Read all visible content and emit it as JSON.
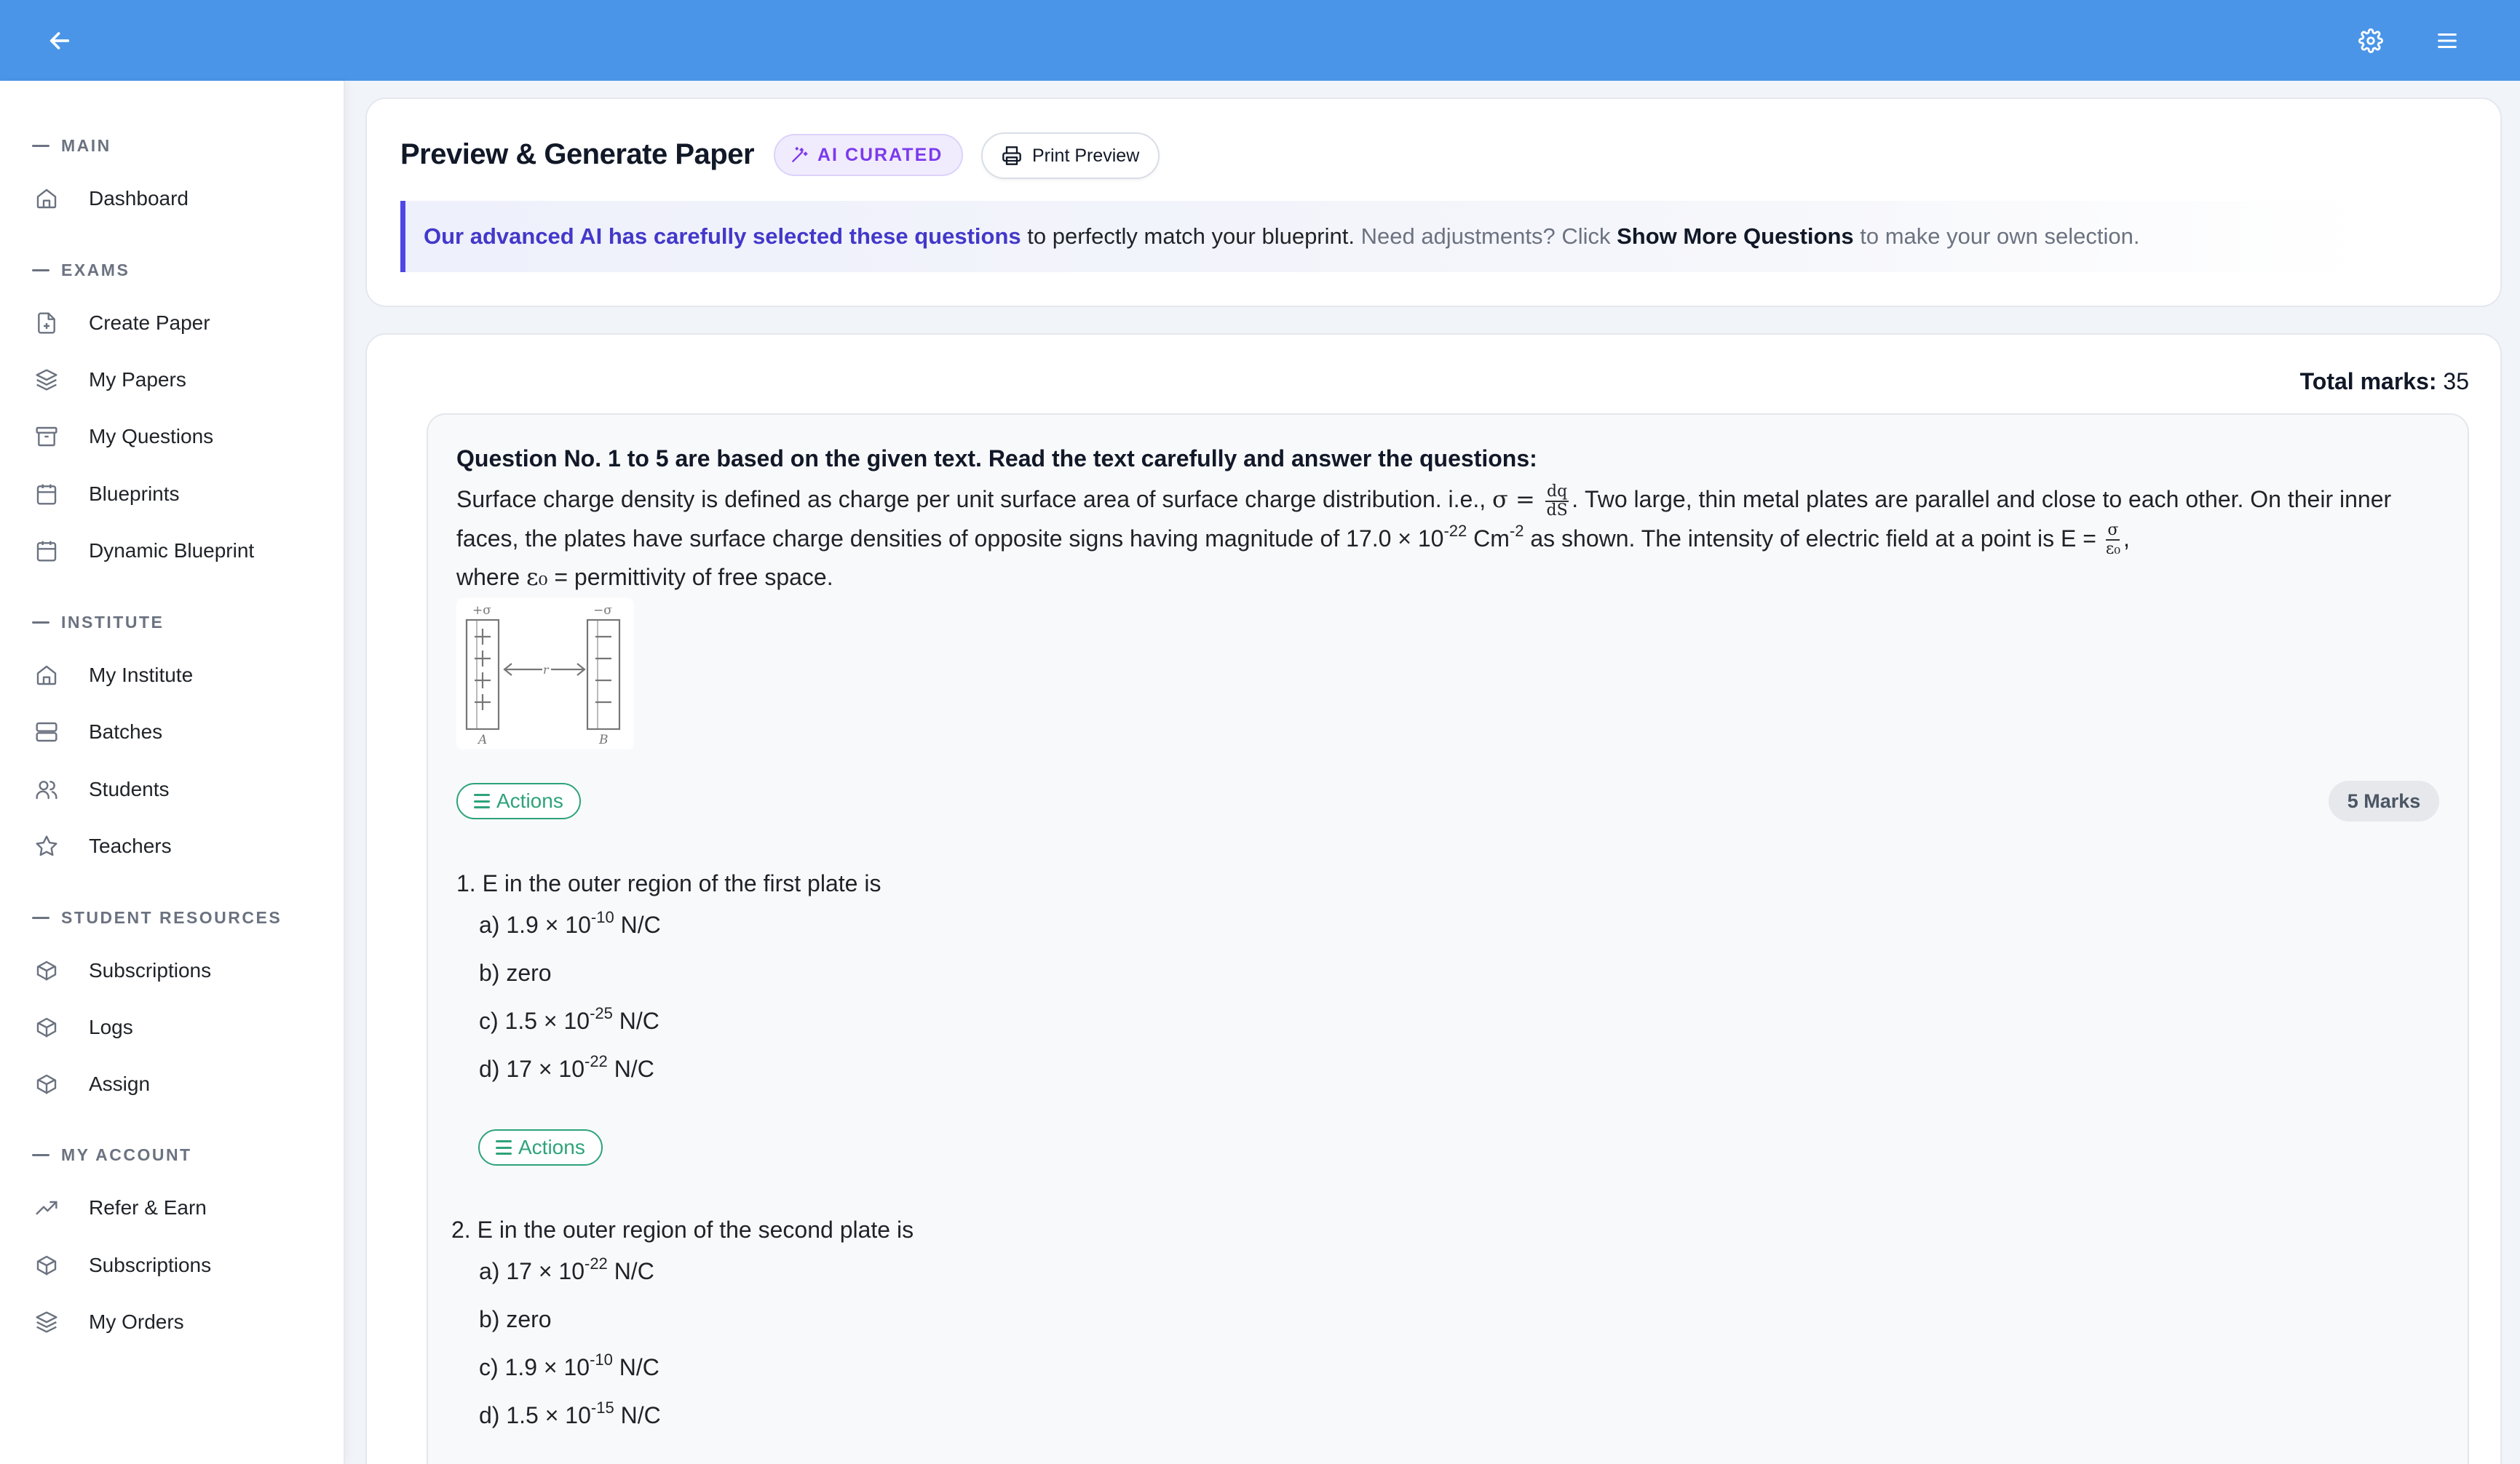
{
  "topbar": {
    "back_icon": "arrow-left-icon",
    "settings_icon": "gear-icon",
    "menu_icon": "hamburger-icon"
  },
  "sidebar": {
    "sections": [
      {
        "title": "MAIN",
        "items": [
          {
            "label": "Dashboard",
            "icon": "home-icon"
          }
        ]
      },
      {
        "title": "EXAMS",
        "items": [
          {
            "label": "Create Paper",
            "icon": "file-plus-icon"
          },
          {
            "label": "My Papers",
            "icon": "layers-icon"
          },
          {
            "label": "My Questions",
            "icon": "archive-icon"
          },
          {
            "label": "Blueprints",
            "icon": "calendar-icon"
          },
          {
            "label": "Dynamic Blueprint",
            "icon": "calendar-icon"
          }
        ]
      },
      {
        "title": "INSTITUTE",
        "items": [
          {
            "label": "My Institute",
            "icon": "home-icon"
          },
          {
            "label": "Batches",
            "icon": "server-icon"
          },
          {
            "label": "Students",
            "icon": "users-icon"
          },
          {
            "label": "Teachers",
            "icon": "star-icon"
          }
        ]
      },
      {
        "title": "STUDENT RESOURCES",
        "items": [
          {
            "label": "Subscriptions",
            "icon": "package-icon"
          },
          {
            "label": "Logs",
            "icon": "package-icon"
          },
          {
            "label": "Assign",
            "icon": "package-icon"
          }
        ]
      },
      {
        "title": "MY ACCOUNT",
        "items": [
          {
            "label": "Refer & Earn",
            "icon": "trending-up-icon"
          },
          {
            "label": "Subscriptions",
            "icon": "package-icon"
          },
          {
            "label": "My Orders",
            "icon": "layers-icon"
          }
        ]
      }
    ]
  },
  "header": {
    "title": "Preview & Generate Paper",
    "ai_badge": "AI CURATED",
    "print_button": "Print Preview",
    "info": {
      "highlight": "Our advanced AI has carefully selected these questions",
      "text1": " to perfectly match your blueprint.",
      "muted1": " Need adjustments? Click ",
      "bold": "Show More Questions",
      "muted2": " to make your own selection."
    }
  },
  "paper": {
    "total_label": "Total marks:",
    "total_value": "35",
    "passage_title": "Question No. 1 to 5 are based on the given text. Read the text carefully and answer the questions:",
    "passage": {
      "p1": "Surface charge density is defined as charge per unit surface area of surface charge distribution. i.e., ",
      "sigma_eq": "σ = ",
      "frac1_num": "dq",
      "frac1_den": "dS",
      "p2": ". Two large, thin metal plates are parallel and close to each other. On their inner faces, the plates have surface charge densities of opposite signs having magnitude of 17.0 × 10",
      "exp1": "-22",
      "p3": " Cm",
      "exp2": "-2",
      "p4": " as shown. The intensity of electric field at a point is E = ",
      "frac2_num": "σ",
      "frac2_den": "ε₀",
      "p5": ",",
      "p6": "where ",
      "eps": "ε₀",
      "p7": " = permittivity of free space."
    },
    "diagram": {
      "top_left": "+σ",
      "top_right": "−σ",
      "mid": "r",
      "bottom_left": "A",
      "bottom_right": "B"
    },
    "actions_label": "Actions",
    "marks_label": "5 Marks",
    "questions": [
      {
        "text": "1. E in the outer region of the first plate is",
        "options": [
          {
            "pre": "a) 1.9 × 10",
            "exp": "-10",
            "post": " N/C"
          },
          {
            "pre": "b) zero",
            "exp": "",
            "post": ""
          },
          {
            "pre": "c) 1.5 × 10",
            "exp": "-25",
            "post": " N/C"
          },
          {
            "pre": "d) 17 × 10",
            "exp": "-22",
            "post": " N/C"
          }
        ]
      },
      {
        "text": "2. E in the outer region of the second plate is",
        "options": [
          {
            "pre": "a) 17 × 10",
            "exp": "-22",
            "post": " N/C"
          },
          {
            "pre": "b) zero",
            "exp": "",
            "post": ""
          },
          {
            "pre": "c) 1.9 × 10",
            "exp": "-10",
            "post": " N/C"
          },
          {
            "pre": "d) 1.5 × 10",
            "exp": "-15",
            "post": " N/C"
          }
        ]
      }
    ]
  },
  "colors": {
    "topbar": "#4a95e8",
    "accent_purple": "#7c3aed",
    "info_border": "#4f46e5",
    "actions_green": "#2ea37a"
  }
}
